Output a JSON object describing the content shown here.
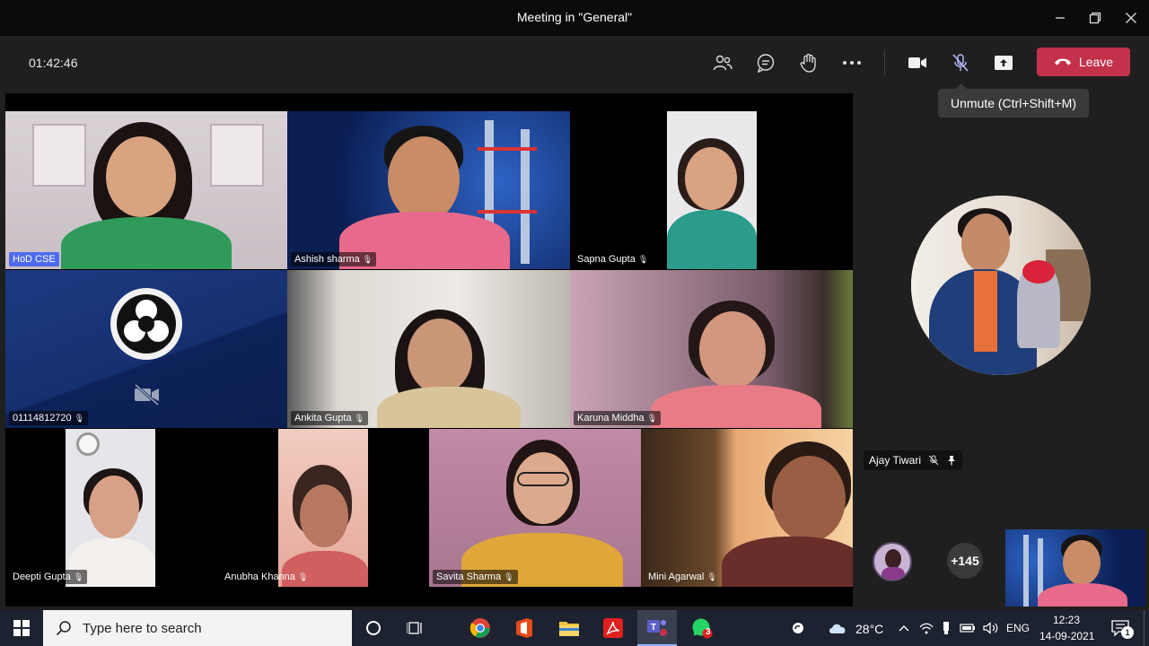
{
  "window": {
    "title": "Meeting in \"General\""
  },
  "toolbar": {
    "timer": "01:42:46",
    "leave_label": "Leave",
    "tooltip": "Unmute (Ctrl+Shift+M)"
  },
  "participants": [
    {
      "name": "HoD CSE"
    },
    {
      "name": "Ashish sharma"
    },
    {
      "name": "Sapna Gupta"
    },
    {
      "name": "01114812720"
    },
    {
      "name": "Ankita Gupta"
    },
    {
      "name": "Karuna Middha"
    },
    {
      "name": "Deepti Gupta"
    },
    {
      "name": "Anubha Khanna"
    },
    {
      "name": "Savita Sharma"
    },
    {
      "name": "Mini Agarwal"
    }
  ],
  "spotlight": {
    "name": "Ajay Tiwari"
  },
  "overflow": {
    "count": "+145"
  },
  "taskbar": {
    "search_placeholder": "Type here to search",
    "teams_badge": "3",
    "weather": "28°C",
    "language": "ENG",
    "time": "12:23",
    "date": "14-09-2021",
    "notification_count": "1"
  },
  "colors": {
    "leave_red": "#c4314b",
    "hod_label": "#4f6bed",
    "taskbar": "#1c2230"
  }
}
